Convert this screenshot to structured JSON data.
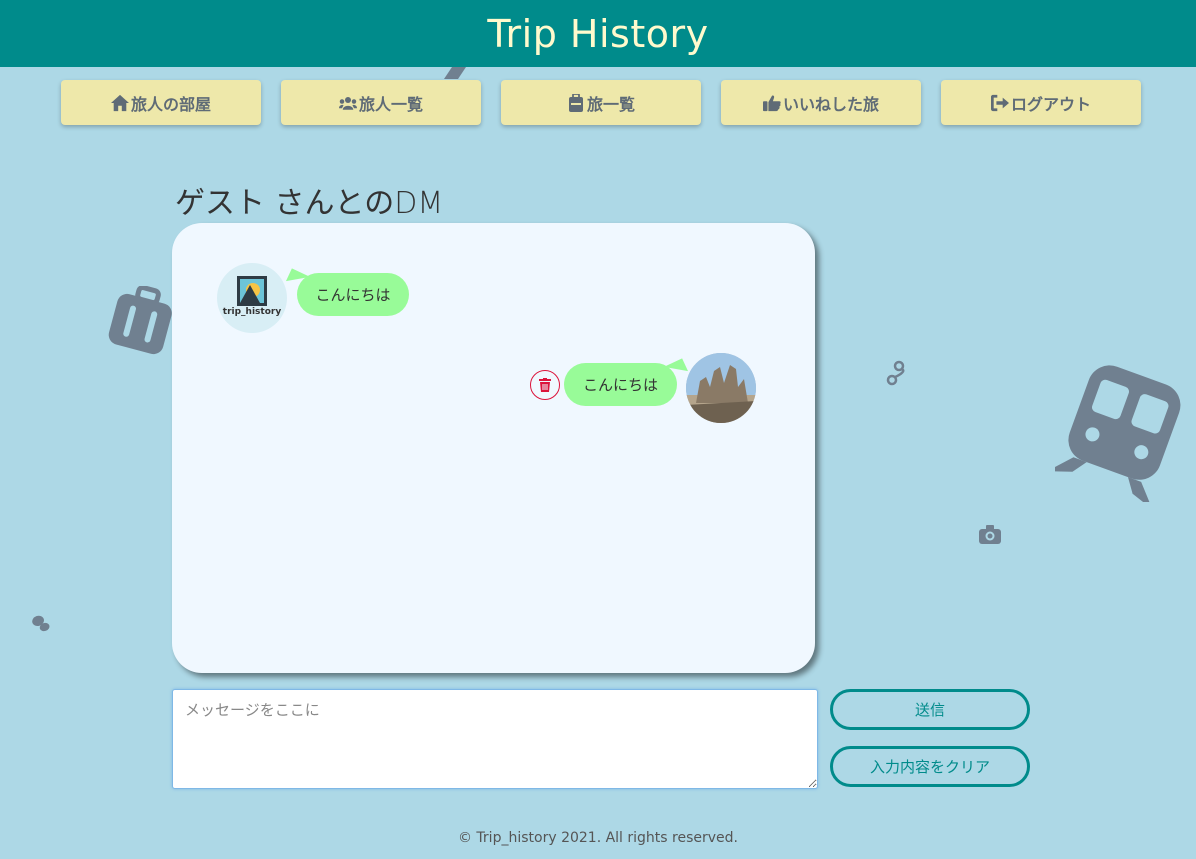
{
  "header": {
    "title": "Trip History"
  },
  "nav": {
    "items": [
      {
        "label": "旅人の部屋",
        "icon": "home-icon"
      },
      {
        "label": "旅人一覧",
        "icon": "users-icon"
      },
      {
        "label": "旅一覧",
        "icon": "suitcase-icon"
      },
      {
        "label": "いいねした旅",
        "icon": "thumbs-up-icon"
      },
      {
        "label": "ログアウト",
        "icon": "sign-out-icon"
      }
    ]
  },
  "page": {
    "title": "ゲスト さんとのDM"
  },
  "chat": {
    "partner_avatar_text": "trip_history",
    "messages": [
      {
        "side": "left",
        "text": "こんにちは"
      },
      {
        "side": "right",
        "text": "こんにちは"
      }
    ]
  },
  "composer": {
    "placeholder": "メッセージをここに",
    "send_label": "送信",
    "clear_label": "入力内容をクリア"
  },
  "footer": {
    "text": "© Trip_history 2021. All rights reserved."
  },
  "colors": {
    "background": "#add8e6",
    "header": "#008b8b",
    "header_text": "#fffacd",
    "nav_button": "#eee8aa",
    "bubble": "#98fb98",
    "chat_box": "#f0f8ff",
    "delete": "#dc143c",
    "decoration": "#708090"
  }
}
